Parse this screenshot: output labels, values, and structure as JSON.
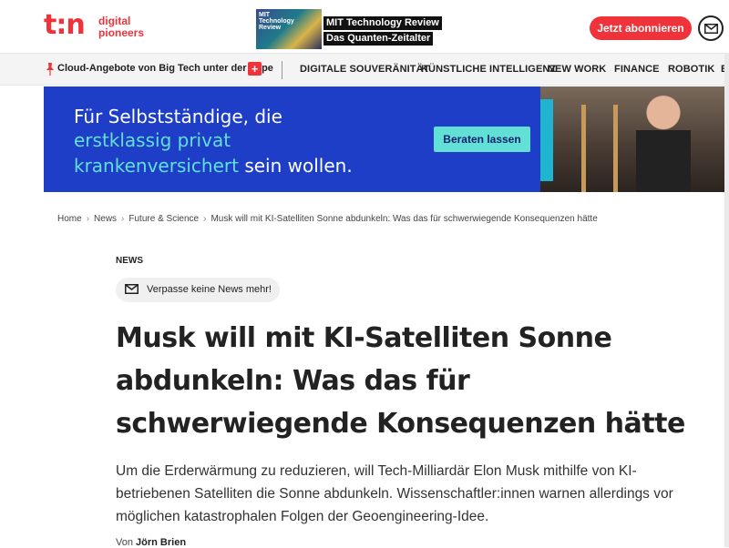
{
  "header": {
    "logo_mark": "t:n",
    "logo_text_line1": "digital",
    "logo_text_line2": "pioneers",
    "promo_thumb_text": "MIT Technology Review",
    "promo_line1": "MIT Technology Review",
    "promo_line2": "Das Quanten-Zeitalter",
    "subscribe_label": "Jetzt abonnieren",
    "mail_icon": "mail-icon"
  },
  "nav": {
    "hot_topic": "Cloud-Angebote von Big Tech unter der Lupe",
    "hot_plus": "+",
    "items": [
      {
        "label": "DIGITALE SOUVERÄNITÄT"
      },
      {
        "label": "KÜNSTLICHE INTELLIGENZ"
      },
      {
        "label": "NEW WORK"
      },
      {
        "label": "FINANCE"
      },
      {
        "label": "ROBOTIK"
      },
      {
        "label": "E"
      }
    ]
  },
  "ad": {
    "line1": "Für Selbstständige, die",
    "line2_highlight": "erstklassig privat",
    "line3_highlight": "krankenversichert",
    "line3_rest": " sein wollen.",
    "cta": "Beraten lassen",
    "colors": {
      "background": "#1e3ec8",
      "accent": "#63e0d6"
    }
  },
  "breadcrumb": {
    "items": [
      "Home",
      "News",
      "Future & Science",
      "Musk will mit KI-Satelliten Sonne abdunkeln: Was das für schwerwiegende Konsequenzen hätte"
    ]
  },
  "article": {
    "kicker": "NEWS",
    "newsletter_pill": "Verpasse keine News mehr!",
    "headline": "Musk will mit KI-Satelliten Sonne abdunkeln: Was das für schwerwiegende Konsequenzen hätte",
    "lead": "Um die Erderwärmung zu reduzieren, will Tech-Milliardär Elon Musk mithilfe von KI-betriebenen Satelliten die Sonne abdunkeln. Wissenschaftler:innen warnen allerdings vor möglichen katastrophalen Folgen der Geoengineering-Idee.",
    "byline_prefix": "Von",
    "author": "Jörn Brien"
  },
  "colors": {
    "brand": "#f0333a",
    "text": "#222222",
    "nav_bg": "#f4f4f4"
  }
}
